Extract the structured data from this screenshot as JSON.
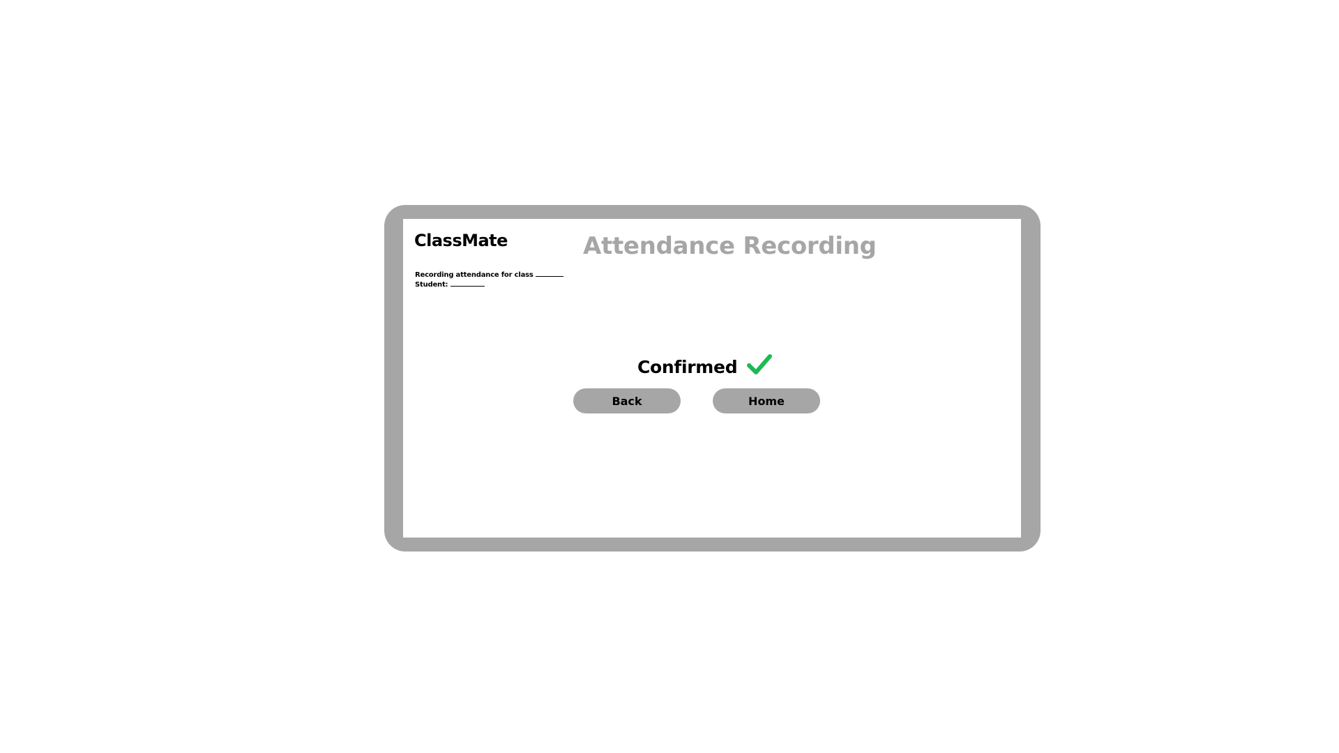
{
  "app": {
    "brand": "ClassMate",
    "title": "Attendance Recording"
  },
  "info": {
    "line1": "Recording attendance for class",
    "line2": "Student:"
  },
  "status": {
    "text": "Confirmed",
    "icon": "checkmark-icon",
    "icon_color": "#1db954"
  },
  "buttons": {
    "back": "Back",
    "home": "Home"
  },
  "colors": {
    "frame": "#a6a6a6",
    "title": "#a6a6a6",
    "button": "#a6a6a6"
  }
}
